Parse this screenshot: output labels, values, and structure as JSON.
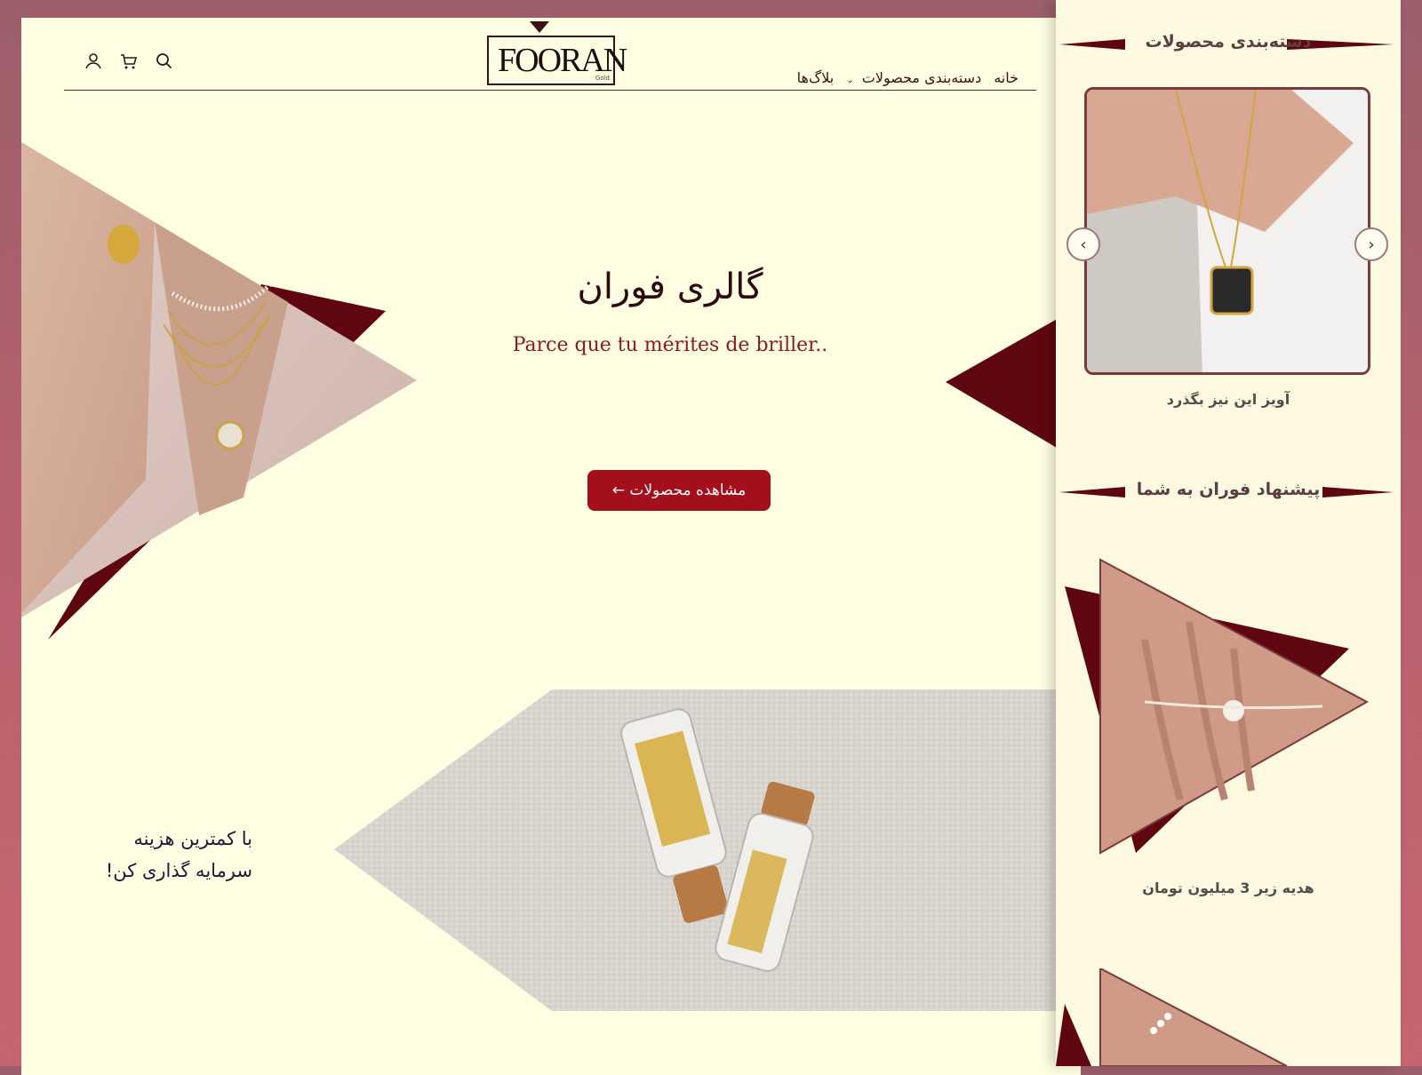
{
  "header": {
    "nav": [
      {
        "label": "خانه"
      },
      {
        "label": "دسته‌بندی محصولات",
        "dropdown": true
      },
      {
        "label": "بلاگ‌ها"
      }
    ],
    "logo_text": "FOORAN",
    "logo_sub": "Gold",
    "icons": [
      "search-icon",
      "cart-icon",
      "user-icon"
    ]
  },
  "hero": {
    "title": "گالری فوران",
    "subtitle": "Parce que tu mérites de briller..",
    "cta_label": "مشاهده محصولات ←"
  },
  "promo": {
    "line1": "با کمترین هزینه",
    "line2": "سرمایه گذاری کن!"
  },
  "sidebar": {
    "categories_title": "دسته‌بندی محصولات",
    "featured_product": "آویز این نیز بگذرد",
    "suggest_title": "پیشنهاد فوران به شما",
    "suggest_product": "هدیه زیر 3 میلیون تومان"
  },
  "colors": {
    "accent": "#a3101c",
    "dark_maroon": "#5e0710",
    "cream": "#fffde2",
    "frame": "#b8626d"
  }
}
